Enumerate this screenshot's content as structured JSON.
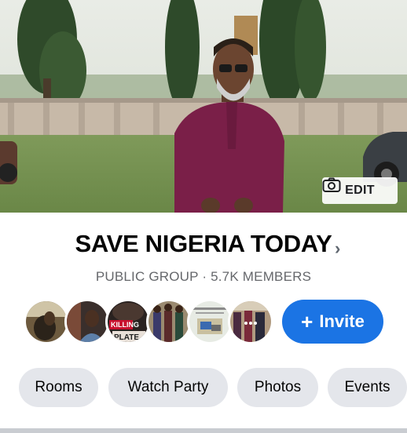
{
  "cover": {
    "edit_label": "EDIT",
    "camera_icon": "camera-icon"
  },
  "group": {
    "name": "SAVE NIGERIA TODAY",
    "chevron": "›",
    "meta": "PUBLIC GROUP · 5.7K MEMBERS"
  },
  "members": {
    "avatars": [
      "member-avatar-1",
      "member-avatar-2",
      "member-avatar-3",
      "member-avatar-4",
      "member-avatar-5",
      "member-avatar-6"
    ],
    "avatar3_text": "KILLING",
    "avatar3_text2": "PLATE"
  },
  "invite": {
    "plus": "+",
    "label": "Invite"
  },
  "tabs": [
    {
      "label": "Rooms"
    },
    {
      "label": "Watch Party"
    },
    {
      "label": "Photos"
    },
    {
      "label": "Events"
    }
  ],
  "colors": {
    "accent": "#1b74e4",
    "chip_bg": "#e4e6eb",
    "shirt": "#7a1f48"
  }
}
